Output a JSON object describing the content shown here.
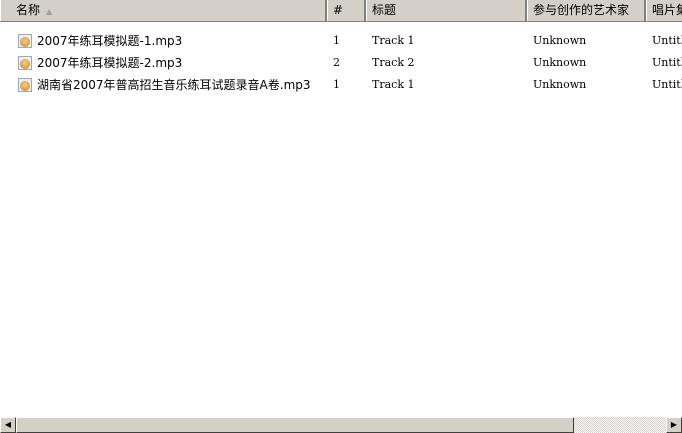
{
  "columns": [
    {
      "label": "名称",
      "sort": "▲"
    },
    {
      "label": "#"
    },
    {
      "label": "标题"
    },
    {
      "label": "参与创作的艺术家"
    },
    {
      "label": "唱片集"
    }
  ],
  "rows": [
    {
      "name": "2007年练耳模拟题-1.mp3",
      "number": "1",
      "title": "Track 1",
      "artist": "Unknown",
      "album": "Untitled"
    },
    {
      "name": "2007年练耳模拟题-2.mp3",
      "number": "2",
      "title": "Track 2",
      "artist": "Unknown",
      "album": "Untitled"
    },
    {
      "name": "湖南省2007年普高招生音乐练耳试题录音A卷.mp3",
      "number": "1",
      "title": "Track 1",
      "artist": "Unknown",
      "album": "Untitled"
    }
  ],
  "scrollbar": {
    "left_arrow": "◀",
    "right_arrow": "▶"
  }
}
